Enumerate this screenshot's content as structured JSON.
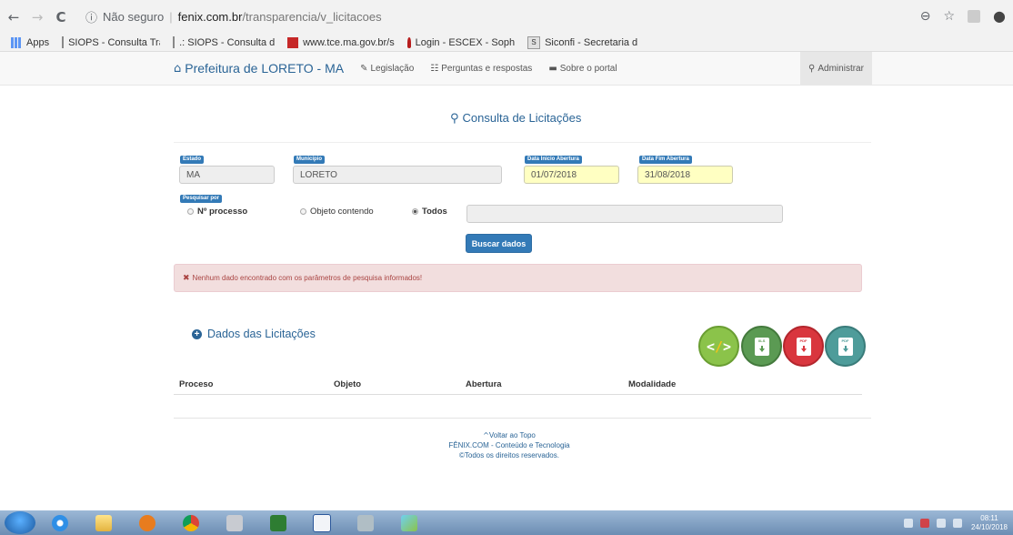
{
  "browser": {
    "back": "←",
    "forward": "→",
    "reload": "C",
    "info_icon": "ⓘ",
    "security_text": "Não seguro",
    "url_host": "fenix.com.br",
    "url_path": "/transparencia/v_licitacoes",
    "zoom_icon": "⊖",
    "star_icon": "☆",
    "profile_icon": "●"
  },
  "bookmarks": [
    {
      "label": "Apps",
      "icon": "apps-icon"
    },
    {
      "label": "SIOPS - Consulta Tra",
      "icon": "page-icon"
    },
    {
      "label": ".: SIOPS - Consulta d",
      "icon": "page-icon"
    },
    {
      "label": "www.tce.ma.gov.br/s",
      "icon": "tce-icon"
    },
    {
      "label": "Login - ESCEX - Soph",
      "icon": "escex-icon"
    },
    {
      "label": "Siconfi - Secretaria d",
      "icon": "siconfi-icon"
    }
  ],
  "site_nav": {
    "home_icon": "⌂",
    "brand": "Prefeitura de LORETO - MA",
    "legislacao": "Legislação",
    "perguntas": "Perguntas e respostas",
    "sobre": "Sobre o portal",
    "admin_icon": "⚲",
    "admin": "Administrar"
  },
  "consulta": {
    "search_icon": "🔍",
    "title": "Consulta de Licitações"
  },
  "form": {
    "estado_label": "Estado",
    "estado_value": "MA",
    "municipio_label": "Município",
    "municipio_value": "LORETO",
    "data_inicio_label": "Data Inicio Abertura",
    "data_inicio_value": "01/07/2018",
    "data_fim_label": "Data Fim Abertura",
    "data_fim_value": "31/08/2018",
    "pesquisar_label": "Pesquisar por",
    "radio_processo": "Nº processo",
    "radio_objeto": "Objeto contendo",
    "radio_todos": "Todos",
    "selected": "Todos",
    "search_value": "",
    "buscar": "Buscar dados"
  },
  "alert": {
    "icon": "✖",
    "text": "Nenhum dado encontrado com os parâmetros de pesquisa informados!"
  },
  "dados": {
    "icon": "+",
    "title": "Dados das Licitações"
  },
  "export_buttons": [
    {
      "name": "code",
      "text": "‹/›",
      "color": "#8bc34a"
    },
    {
      "name": "xls",
      "text": "XLS",
      "color": "#5b9a53"
    },
    {
      "name": "pdf",
      "text": "PDF",
      "color": "#d9363e"
    },
    {
      "name": "pdf2",
      "text": "PDF",
      "color": "#4e9c9a"
    }
  ],
  "table": {
    "headers": [
      "Proceso",
      "Objeto",
      "Abertura",
      "Modalidade"
    ]
  },
  "footer": {
    "top_icon": "^",
    "back_to_top": "Voltar ao Topo",
    "company": "FÊNIX.COM - Conteúdo e Tecnologia",
    "rights": "©Todos os direitos reservados."
  },
  "taskbar": {
    "time": "08:11",
    "date": "24/10/2018"
  }
}
